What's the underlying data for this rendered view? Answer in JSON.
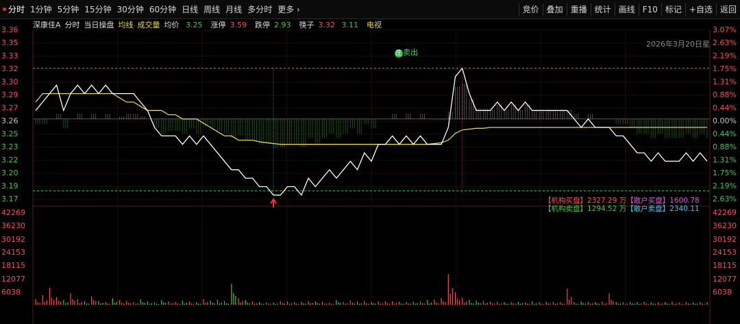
{
  "toolbar": {
    "tabs": [
      "分时",
      "1分钟",
      "5分钟",
      "15分钟",
      "30分钟",
      "60分钟",
      "日线",
      "周线",
      "月线",
      "多分时",
      "更多 ›"
    ],
    "active_tab": 0,
    "right_buttons": [
      "竞价",
      "叠加",
      "重播",
      "统计",
      "画线",
      "F10",
      "标记",
      "+自选",
      "返回"
    ]
  },
  "info": {
    "stock_name": "深康佳A",
    "mode": "分时",
    "panel": "当日操盘",
    "avg_line": "均线",
    "volume_label": "成交量",
    "avg_price_label": "均价",
    "avg_price": "3.25",
    "limit_up_label": "涨停",
    "limit_up": "3.59",
    "limit_down_label": "跌停",
    "limit_down": "2.93",
    "chopsticks_label": "筷子",
    "chop_red": "3.32",
    "chop_green": "3.11",
    "tv_label": "电视"
  },
  "date_label": "2026年3月20日星",
  "sell_marker": "卖出",
  "sell_marker_badge": "庄",
  "flow": {
    "buy_inst_label": "【机构买盘】",
    "buy_inst": "2327.29 万",
    "buy_retail_label": "【散户买盘】",
    "buy_retail": "1600.78",
    "sell_inst_label": "【机构卖盘】",
    "sell_inst": "1294.52 万",
    "sell_retail_label": "【散户卖盘】",
    "sell_retail": "2340.11"
  },
  "price_axis": [
    "3.36",
    "3.35",
    "3.33",
    "3.32",
    "3.30",
    "3.29",
    "3.27",
    "3.26",
    "3.25",
    "3.23",
    "3.22",
    "3.20",
    "3.19",
    "3.17"
  ],
  "pct_axis": [
    "3.07%",
    "2.63%",
    "2.19%",
    "1.75%",
    "1.31%",
    "0.88%",
    "0.44%",
    "0.00%",
    "0.44%",
    "0.88%",
    "1.31%",
    "1.75%",
    "2.19%",
    "2.63%"
  ],
  "volume_axis": [
    "42269",
    "36230",
    "30192",
    "24153",
    "18115",
    "12077",
    "6038"
  ],
  "colors": {
    "price_line": "#ffffff",
    "avg_line": "#e6d84a",
    "up": "#ff4b4b",
    "down": "#3fc74a",
    "grid": "#2a1010"
  },
  "chart_data": {
    "type": "line",
    "title": "",
    "xlabel": "",
    "ylabel": "",
    "ylim": [
      3.165,
      3.365
    ],
    "prev_close": 3.26,
    "series": [
      {
        "name": "分时",
        "values": [
          3.27,
          3.28,
          3.29,
          3.3,
          3.27,
          3.29,
          3.3,
          3.29,
          3.3,
          3.29,
          3.3,
          3.29,
          3.29,
          3.29,
          3.29,
          3.28,
          3.27,
          3.25,
          3.24,
          3.24,
          3.24,
          3.23,
          3.24,
          3.23,
          3.24,
          3.23,
          3.22,
          3.21,
          3.2,
          3.2,
          3.19,
          3.19,
          3.18,
          3.18,
          3.17,
          3.17,
          3.18,
          3.18,
          3.17,
          3.19,
          3.18,
          3.19,
          3.2,
          3.19,
          3.2,
          3.21,
          3.2,
          3.22,
          3.21,
          3.23,
          3.23,
          3.24,
          3.23,
          3.24,
          3.23,
          3.24,
          3.23,
          3.23,
          3.23,
          3.25,
          3.31,
          3.32,
          3.29,
          3.27,
          3.27,
          3.27,
          3.28,
          3.27,
          3.28,
          3.27,
          3.28,
          3.27,
          3.27,
          3.27,
          3.27,
          3.27,
          3.27,
          3.26,
          3.25,
          3.26,
          3.25,
          3.25,
          3.25,
          3.24,
          3.24,
          3.23,
          3.22,
          3.22,
          3.21,
          3.22,
          3.21,
          3.21,
          3.21,
          3.22,
          3.21,
          3.22,
          3.21
        ]
      },
      {
        "name": "均价",
        "values": [
          3.28,
          3.29,
          3.29,
          3.29,
          3.29,
          3.29,
          3.29,
          3.29,
          3.29,
          3.29,
          3.29,
          3.29,
          3.285,
          3.28,
          3.28,
          3.275,
          3.27,
          3.27,
          3.27,
          3.265,
          3.265,
          3.26,
          3.26,
          3.26,
          3.255,
          3.25,
          3.245,
          3.24,
          3.24,
          3.235,
          3.235,
          3.235,
          3.233,
          3.232,
          3.231,
          3.23,
          3.23,
          3.23,
          3.23,
          3.23,
          3.23,
          3.23,
          3.23,
          3.23,
          3.23,
          3.23,
          3.23,
          3.23,
          3.23,
          3.23,
          3.23,
          3.23,
          3.23,
          3.23,
          3.23,
          3.23,
          3.23,
          3.231,
          3.232,
          3.235,
          3.243,
          3.247,
          3.248,
          3.249,
          3.249,
          3.25,
          3.25,
          3.25,
          3.25,
          3.25,
          3.25,
          3.25,
          3.25,
          3.25,
          3.25,
          3.25,
          3.25,
          3.25,
          3.25,
          3.25,
          3.25,
          3.25,
          3.25,
          3.25,
          3.25,
          3.25,
          3.25,
          3.25,
          3.25,
          3.25,
          3.25,
          3.25,
          3.25,
          3.25,
          3.25,
          3.25,
          3.25
        ]
      }
    ],
    "volume": [
      3000,
      5000,
      9000,
      4000,
      2500,
      6000,
      3000,
      2000,
      4500,
      2000,
      1500,
      3500,
      2500,
      2000,
      1500,
      3000,
      1800,
      1200,
      2500,
      1800,
      1500,
      2200,
      1700,
      1300,
      3000,
      2200,
      2600,
      2000,
      11000,
      3500,
      2500,
      1800,
      1500,
      1300,
      1200,
      2000,
      1800,
      1500,
      1500,
      2000,
      1800,
      1600,
      1200,
      2500,
      1500,
      2200,
      1800,
      2000,
      1500,
      1700,
      1800,
      1900,
      1600,
      1500,
      1700,
      1900,
      2500,
      2800,
      3500,
      16000,
      6500,
      3500,
      2500,
      2200,
      2000,
      1800,
      1700,
      1500,
      1500,
      1600,
      1400,
      1800,
      1500,
      1700,
      1600,
      1500,
      8500,
      1500,
      1700,
      1600,
      1500,
      1800,
      6000,
      1500,
      1400,
      1600,
      1400,
      1700,
      1300,
      1500,
      1400,
      1600,
      1300,
      1500,
      1400,
      1500,
      1400
    ]
  }
}
